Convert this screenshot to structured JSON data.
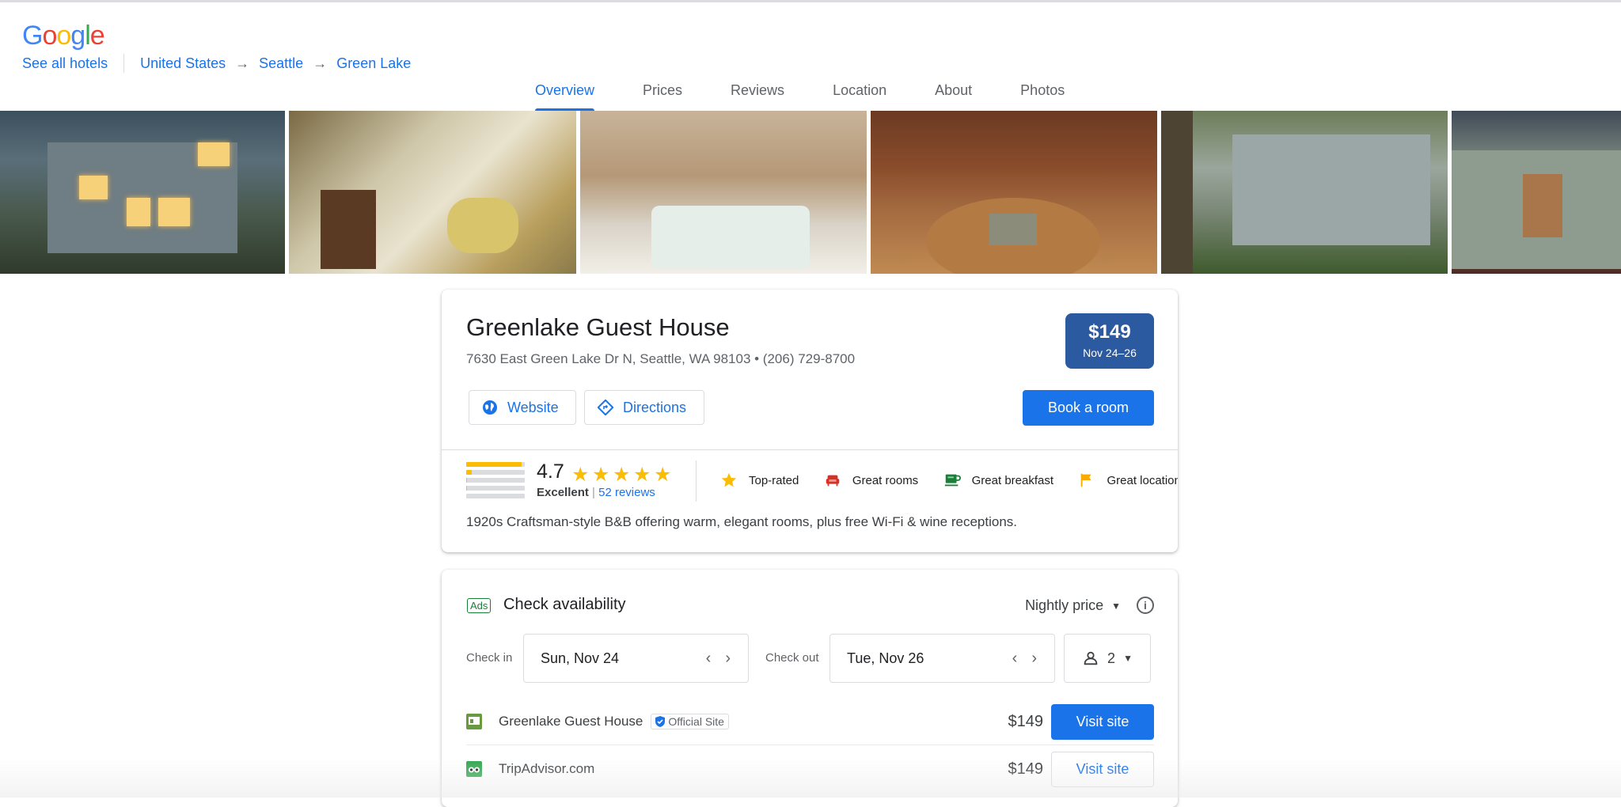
{
  "brand": {
    "logo_letters": [
      "G",
      "o",
      "o",
      "g",
      "l",
      "e"
    ]
  },
  "breadcrumb": {
    "all_hotels": "See all hotels",
    "path": [
      "United States",
      "Seattle",
      "Green Lake"
    ],
    "arrow": "→"
  },
  "tabs": [
    "Overview",
    "Prices",
    "Reviews",
    "Location",
    "About",
    "Photos"
  ],
  "active_tab": "Overview",
  "hotel": {
    "name": "Greenlake Guest House",
    "address": "7630 East Green Lake Dr N, Seattle, WA 98103 • (206) 729-8700",
    "price": "$149",
    "price_dates": "Nov 24–26",
    "website_label": "Website",
    "directions_label": "Directions",
    "book_label": "Book a room",
    "rating": "4.7",
    "stars": "★★★★★",
    "rating_word": "Excellent",
    "rating_sep": " | ",
    "reviews": "52 reviews",
    "rating_distribution": [
      0.94,
      0.1,
      0.02,
      0.02,
      0
    ],
    "amenities": [
      {
        "label": "Top-rated",
        "icon": "star-icon"
      },
      {
        "label": "Great rooms",
        "icon": "armchair-icon"
      },
      {
        "label": "Great breakfast",
        "icon": "coffee-icon"
      },
      {
        "label": "Great location",
        "icon": "flag-icon"
      }
    ],
    "description": "1920s Craftsman-style B&B offering warm, elegant rooms, plus free Wi-Fi & wine receptions."
  },
  "availability": {
    "ads_label": "Ads",
    "title": "Check availability",
    "nightly_label": "Nightly price",
    "info_symbol": "i",
    "checkin_label": "Check in",
    "checkin_value": "Sun, Nov 24",
    "checkout_label": "Check out",
    "checkout_value": "Tue, Nov 26",
    "guests": "2",
    "prev_symbol": "‹",
    "next_symbol": "›",
    "caret": "▼",
    "offers": [
      {
        "provider": "Greenlake Guest House",
        "badge": "Official Site",
        "price": "$149",
        "button": "Visit site"
      },
      {
        "provider": "TripAdvisor.com",
        "price": "$149",
        "button": "Visit site"
      }
    ]
  },
  "colors": {
    "accent": "#1a73e8",
    "price_badge": "#2c5aa0",
    "star": "#fbbc04",
    "ads_green": "#188038"
  }
}
